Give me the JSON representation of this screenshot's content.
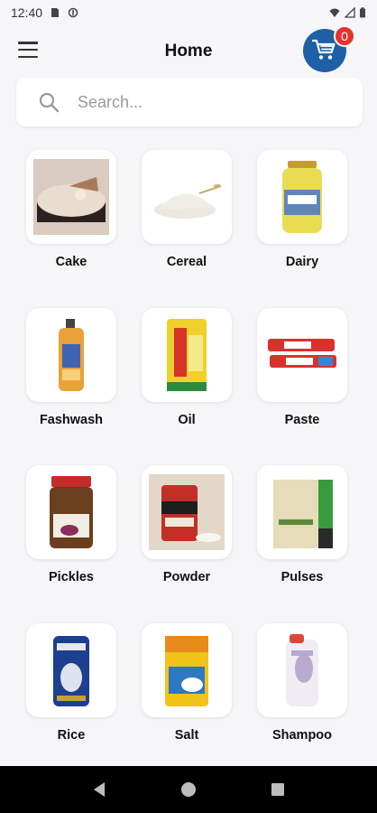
{
  "status": {
    "time": "12:40"
  },
  "header": {
    "title": "Home",
    "cart_count": "0"
  },
  "search": {
    "placeholder": "Search..."
  },
  "categories": [
    {
      "label": "Cake"
    },
    {
      "label": "Cereal"
    },
    {
      "label": "Dairy"
    },
    {
      "label": "Fashwash"
    },
    {
      "label": "Oil"
    },
    {
      "label": "Paste"
    },
    {
      "label": "Pickles"
    },
    {
      "label": "Powder"
    },
    {
      "label": "Pulses"
    },
    {
      "label": "Rice"
    },
    {
      "label": "Salt"
    },
    {
      "label": "Shampoo"
    }
  ],
  "colors": {
    "accent": "#1f5fa6",
    "badge": "#e5322d",
    "background": "#f6f6f8"
  }
}
